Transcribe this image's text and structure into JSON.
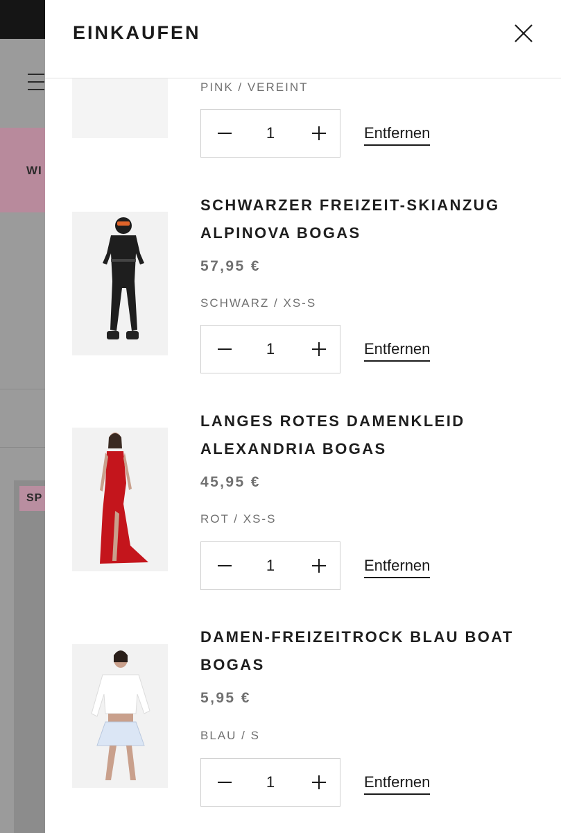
{
  "background": {
    "banner_text": "WI",
    "badge_text": "SP"
  },
  "cart": {
    "title": "EINKAUFEN",
    "remove_label": "Entfernen",
    "items": [
      {
        "name": "",
        "price": "",
        "variant": "PINK / VEREINT",
        "quantity": "1"
      },
      {
        "name": "SCHWARZER FREIZEIT-SKIANZUG ALPINOVA BOGAS",
        "price": "57,95 €",
        "variant": "SCHWARZ / XS-S",
        "quantity": "1"
      },
      {
        "name": "LANGES ROTES DAMENKLEID ALEXANDRIA BOGAS",
        "price": "45,95 €",
        "variant": "ROT / XS-S",
        "quantity": "1"
      },
      {
        "name": "DAMEN-FREIZEITROCK BLAU BOAT BOGAS",
        "price": "5,95 €",
        "variant": "BLAU / S",
        "quantity": "1"
      }
    ]
  },
  "colors": {
    "overlay_gray": "#9b9b9b",
    "accent_pink": "#b88a9c",
    "text_dark": "#1a1a1a",
    "text_muted": "#707070"
  }
}
